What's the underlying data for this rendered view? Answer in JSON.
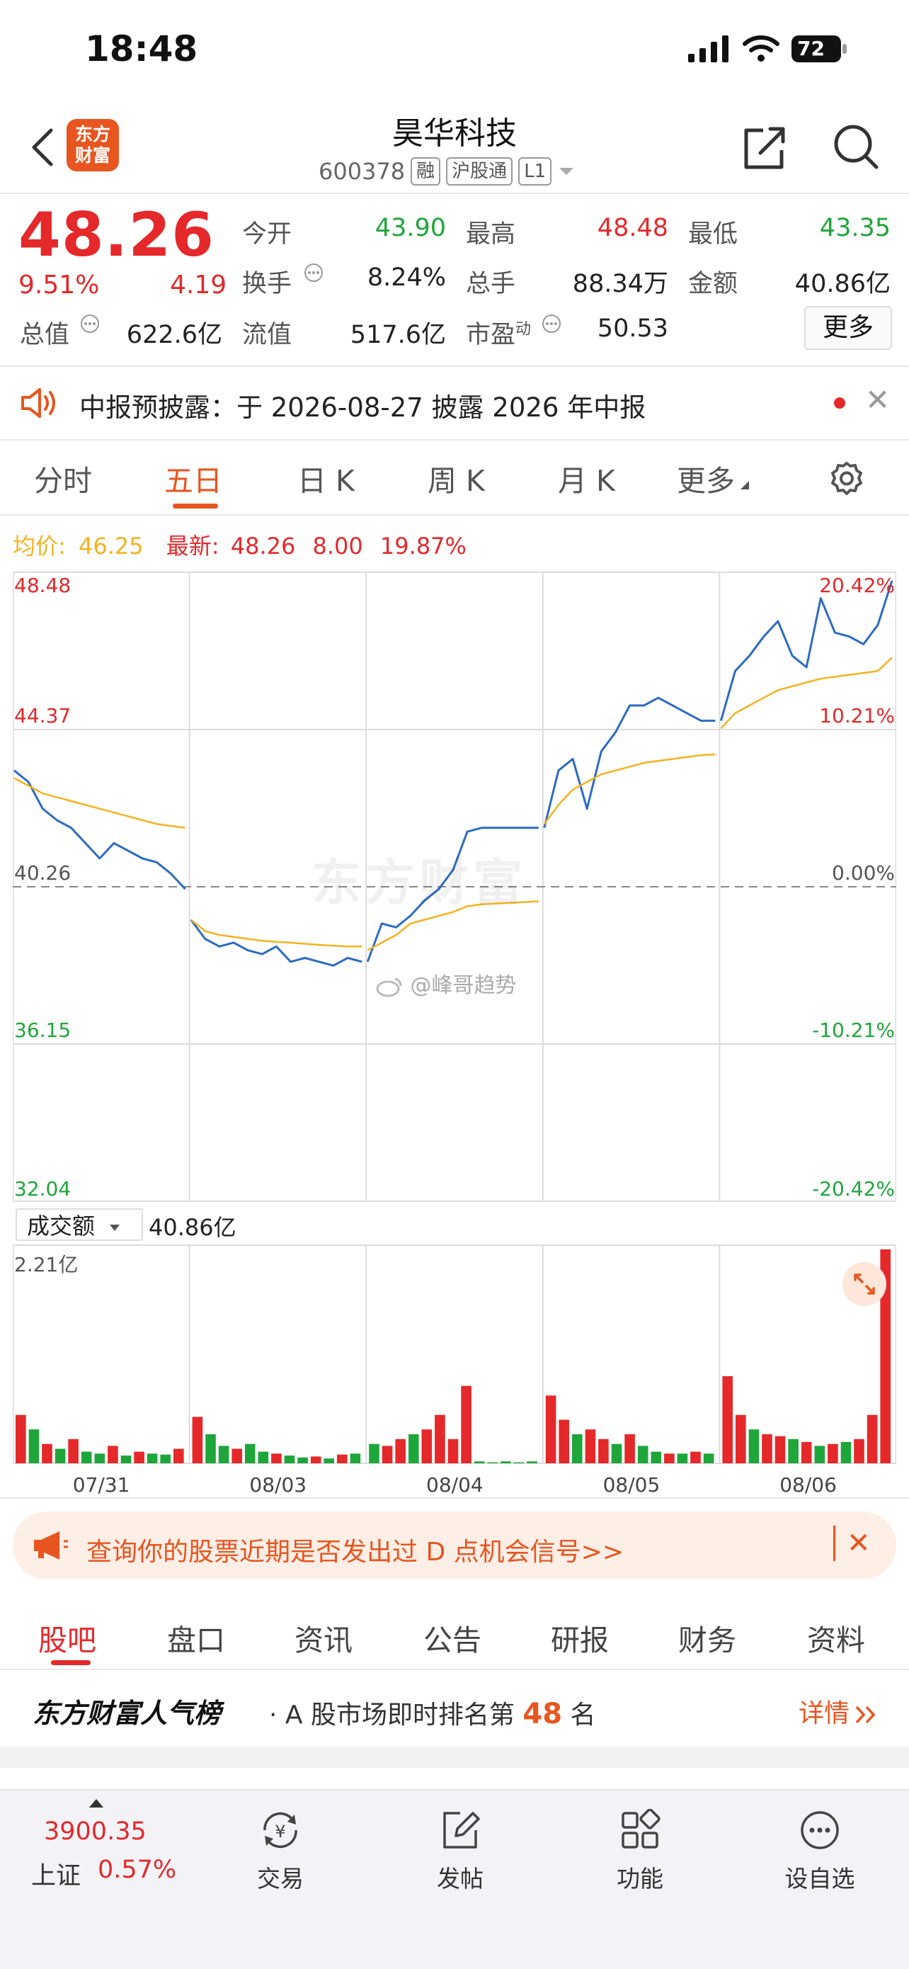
{
  "status": {
    "time": "18:48",
    "battery": "72"
  },
  "header": {
    "logo": [
      "东方",
      "财富"
    ],
    "title": "昊华科技",
    "code": "600378",
    "tags": [
      "融",
      "沪股通",
      "L1"
    ]
  },
  "quote": {
    "price": "48.26",
    "change_pct": "9.51%",
    "change": "4.19",
    "fields": [
      {
        "label": "今开",
        "value": "43.90",
        "color": "green"
      },
      {
        "label": "最高",
        "value": "48.48",
        "color": "red"
      },
      {
        "label": "最低",
        "value": "43.35",
        "color": "green"
      },
      {
        "label": "换手",
        "value": "8.24%",
        "color": "black",
        "info": true
      },
      {
        "label": "总手",
        "value": "88.34万",
        "color": "black"
      },
      {
        "label": "金额",
        "value": "40.86亿",
        "color": "black"
      },
      {
        "label": "总值",
        "value": "622.6亿",
        "color": "black",
        "info": true
      },
      {
        "label": "流值",
        "value": "517.6亿",
        "color": "black"
      },
      {
        "label": "市盈",
        "sup": "动",
        "value": "50.53",
        "color": "black",
        "info": true
      }
    ],
    "more": "更多"
  },
  "notice": {
    "text": "中报预披露：于 2026-08-27 披露 2026 年中报"
  },
  "chart_tabs": [
    "分时",
    "五日",
    "日 K",
    "周 K",
    "月 K",
    "更多"
  ],
  "info_line": {
    "avg_label": "均价:",
    "avg_value": "46.25",
    "latest_label": "最新:",
    "latest_value": "48.26",
    "latest_change": "8.00",
    "latest_pct": "19.87%"
  },
  "chart_data": {
    "type": "line",
    "title": "",
    "x_labels": [
      "07/31",
      "08/03",
      "08/04",
      "08/05",
      "08/06"
    ],
    "ylim": [
      32.04,
      48.48
    ],
    "y_ticks": [
      "48.48",
      "44.37",
      "40.26",
      "36.15",
      "32.04"
    ],
    "y_ticks_pct": [
      "20.42%",
      "10.21%",
      "0.00%",
      "-10.21%",
      "-20.42%"
    ],
    "baseline": 40.26,
    "series": [
      {
        "name": "",
        "color": "#2d6bc2",
        "days": [
          [
            43.3,
            43.0,
            42.3,
            42.0,
            41.8,
            41.4,
            41.0,
            41.4,
            41.2,
            41.0,
            40.9,
            40.6,
            40.2
          ],
          [
            39.4,
            38.9,
            38.7,
            38.8,
            38.6,
            38.5,
            38.7,
            38.3,
            38.4,
            38.3,
            38.2,
            38.4,
            38.3
          ],
          [
            38.3,
            39.3,
            39.2,
            39.5,
            39.9,
            40.2,
            40.7,
            41.7,
            41.8,
            41.8,
            41.8,
            41.8,
            41.8
          ],
          [
            41.8,
            43.3,
            43.6,
            42.3,
            43.8,
            44.3,
            45.0,
            45.0,
            45.2,
            45.0,
            44.8,
            44.6,
            44.6
          ],
          [
            44.6,
            45.9,
            46.3,
            46.8,
            47.2,
            46.3,
            46.0,
            47.8,
            46.9,
            46.8,
            46.6,
            47.1,
            48.26
          ]
        ]
      },
      {
        "name": "均价",
        "color": "#f5b220",
        "days": [
          [
            43.1,
            42.9,
            42.7,
            42.6,
            42.5,
            42.4,
            42.3,
            42.2,
            42.1,
            42.0,
            41.9,
            41.85,
            41.8
          ],
          [
            39.4,
            39.1,
            39.0,
            38.95,
            38.9,
            38.85,
            38.82,
            38.8,
            38.77,
            38.74,
            38.72,
            38.7,
            38.7
          ],
          [
            38.6,
            38.8,
            39.0,
            39.3,
            39.4,
            39.5,
            39.6,
            39.75,
            39.8,
            39.82,
            39.84,
            39.86,
            39.88
          ],
          [
            41.9,
            42.4,
            42.8,
            43.0,
            43.2,
            43.3,
            43.4,
            43.5,
            43.55,
            43.6,
            43.65,
            43.7,
            43.72
          ],
          [
            44.4,
            44.8,
            45.0,
            45.2,
            45.4,
            45.5,
            45.6,
            45.7,
            45.75,
            45.8,
            45.85,
            45.9,
            46.25
          ]
        ]
      }
    ]
  },
  "volume": {
    "selector": "成交额",
    "value": "40.86亿",
    "max_label": "2.21亿",
    "max": 2.21,
    "unit": "亿",
    "colors": {
      "up": "#e5282a",
      "down": "#1fa63a"
    },
    "days": [
      [
        0.5,
        0.35,
        0.2,
        0.15,
        0.25,
        0.12,
        0.1,
        0.18,
        0.08,
        0.12,
        0.1,
        0.09,
        0.15
      ],
      [
        0.48,
        0.3,
        0.18,
        0.15,
        0.2,
        0.12,
        0.1,
        0.08,
        0.06,
        0.07,
        0.05,
        0.09,
        0.1
      ],
      [
        0.2,
        0.18,
        0.25,
        0.3,
        0.35,
        0.5,
        0.25,
        0.8,
        0.02,
        0.01,
        0.02,
        0.01,
        0.02
      ],
      [
        0.7,
        0.45,
        0.3,
        0.35,
        0.25,
        0.2,
        0.3,
        0.18,
        0.12,
        0.1,
        0.1,
        0.12,
        0.1
      ],
      [
        0.9,
        0.5,
        0.35,
        0.3,
        0.28,
        0.25,
        0.22,
        0.18,
        0.2,
        0.22,
        0.25,
        0.5,
        2.21
      ]
    ],
    "up_flags": [
      [
        1,
        0,
        1,
        0,
        1,
        0,
        0,
        1,
        0,
        1,
        0,
        0,
        1
      ],
      [
        1,
        0,
        0,
        1,
        0,
        0,
        1,
        0,
        0,
        1,
        0,
        1,
        0
      ],
      [
        0,
        1,
        1,
        0,
        1,
        1,
        1,
        1,
        0,
        0,
        0,
        0,
        0
      ],
      [
        1,
        1,
        0,
        1,
        1,
        0,
        1,
        0,
        0,
        1,
        0,
        1,
        0
      ],
      [
        1,
        1,
        0,
        1,
        1,
        0,
        1,
        0,
        1,
        0,
        1,
        1,
        1
      ]
    ]
  },
  "watermark": "东方财富",
  "weibo_watermark": "@峰哥趋势",
  "banner": {
    "text": "查询你的股票近期是否发出过 D 点机会信号>>"
  },
  "section_tabs": [
    "股吧",
    "盘口",
    "资讯",
    "公告",
    "研报",
    "财务",
    "资料"
  ],
  "rank": {
    "brand": "东方财富人气榜",
    "text_prefix": "· A 股市场即时排名第",
    "rank": "48",
    "text_suffix": "名",
    "detail": "详情"
  },
  "bottom": {
    "index_value": "3900.35",
    "index_name": "上证",
    "index_pct": "0.57%",
    "nav": [
      "交易",
      "发帖",
      "功能",
      "设自选"
    ]
  }
}
